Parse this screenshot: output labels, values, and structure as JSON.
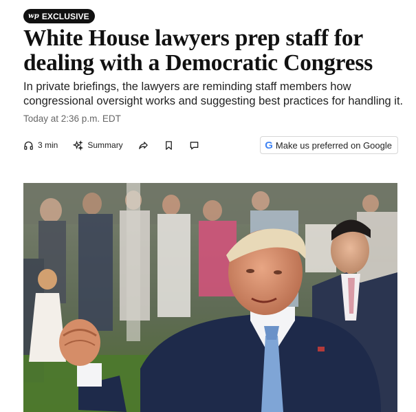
{
  "badge": {
    "logo": "wp",
    "label": "EXCLUSIVE"
  },
  "article": {
    "headline": "White House lawyers prep staff for dealing with a Democratic Congress",
    "dek": "In private briefings, the lawyers are reminding staff members how congressional oversight works and suggesting best practices for handling it.",
    "timestamp": "Today at 2:36 p.m. EDT"
  },
  "toolbar": {
    "listen_label": "3 min",
    "summary_label": "Summary",
    "google_label": "Make us preferred on Google",
    "google_logo": "G"
  },
  "icons": {
    "listen": "headphones-icon",
    "summary": "sparkle-icon",
    "share": "share-arrow-icon",
    "save": "bookmark-icon",
    "comment": "comment-icon"
  }
}
